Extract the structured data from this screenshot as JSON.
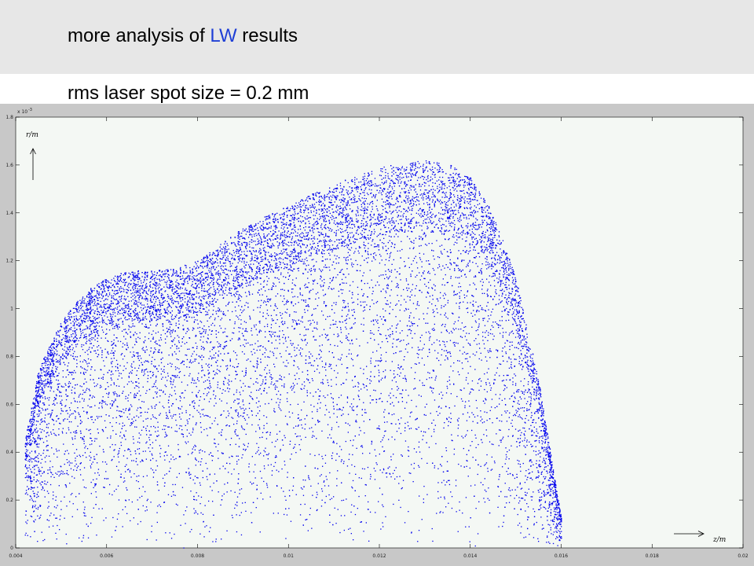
{
  "slide": {
    "title_prefix": "more analysis of ",
    "title_highlight": "LW",
    "title_suffix": " results",
    "subtitle": "rms laser spot size = 0.2 mm",
    "highlight_color": "#1f3fd6"
  },
  "chart_data": {
    "type": "scatter",
    "title": "",
    "xlabel": "z/m",
    "ylabel": "r/m",
    "xlim": [
      0.004,
      0.02
    ],
    "ylim": [
      0,
      0.0018
    ],
    "y_exponent_label": "x 10",
    "y_exponent_power": "-3",
    "x_ticks": [
      "0.004",
      "0.006",
      "0.008",
      "0.01",
      "0.012",
      "0.014",
      "0.016",
      "0.018",
      "0.02"
    ],
    "y_ticks": [
      "0",
      "0.2",
      "0.4",
      "0.6",
      "0.8",
      "1",
      "1.2",
      "1.4",
      "1.6",
      "1.8"
    ],
    "grid": false,
    "marker_color": "#0000ee",
    "background_color": "#f4f8f4",
    "series": [
      {
        "envelope_x": [
          0.0042,
          0.0045,
          0.005,
          0.0055,
          0.006,
          0.0065,
          0.007,
          0.0075,
          0.008,
          0.0085,
          0.009,
          0.0095,
          0.01,
          0.0105,
          0.011,
          0.0115,
          0.012,
          0.0125,
          0.013,
          0.0135,
          0.014,
          0.0145,
          0.015,
          0.0155,
          0.016
        ],
        "envelope_rmax": [
          0.00045,
          0.00075,
          0.00095,
          0.00107,
          0.00113,
          0.00116,
          0.00116,
          0.00117,
          0.0012,
          0.00127,
          0.00134,
          0.00139,
          0.00143,
          0.00148,
          0.00152,
          0.00156,
          0.00159,
          0.00161,
          0.00162,
          0.00161,
          0.00155,
          0.0014,
          0.00113,
          0.0007,
          0.00012
        ]
      }
    ]
  }
}
